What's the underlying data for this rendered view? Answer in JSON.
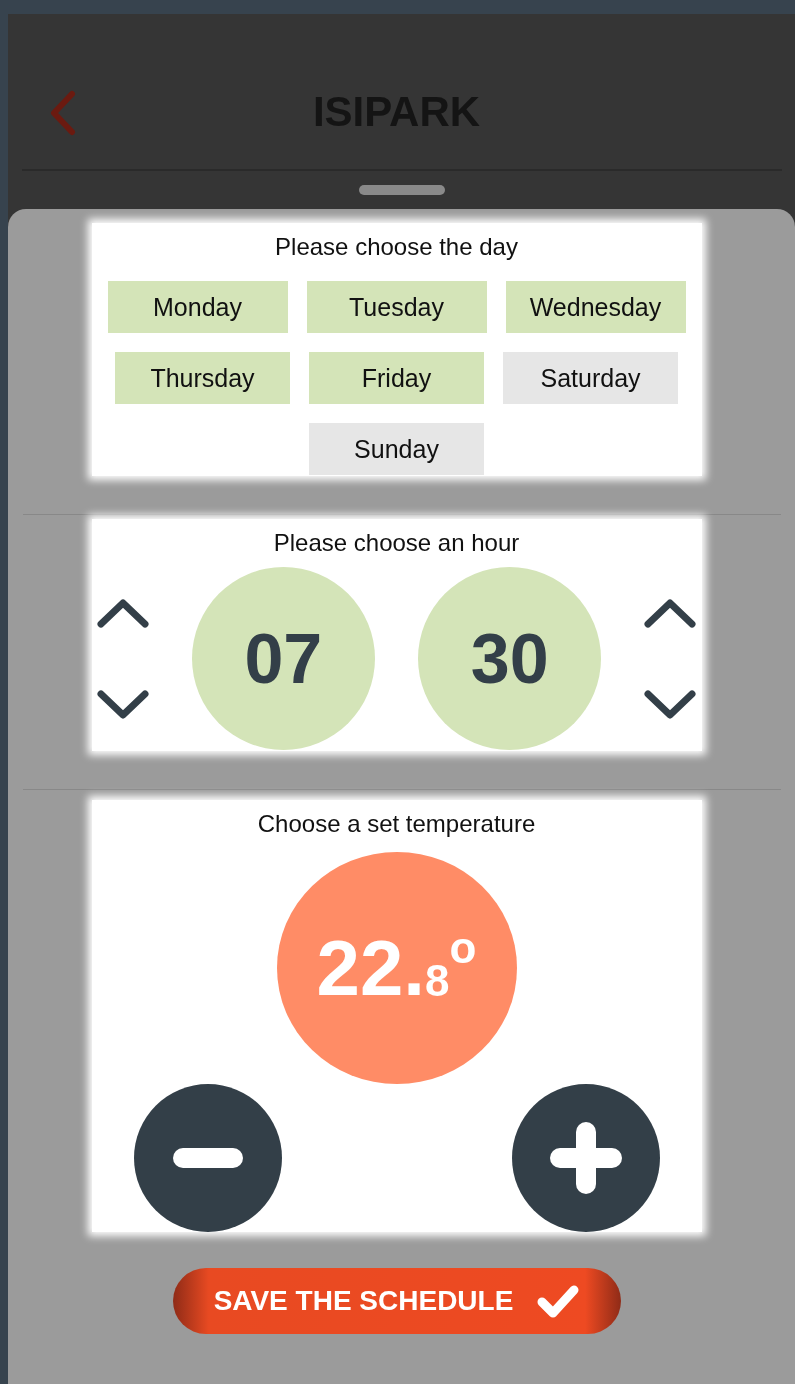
{
  "header": {
    "title": "ISIPARK"
  },
  "day_card": {
    "title": "Please choose the day",
    "days": [
      {
        "label": "Monday",
        "selected": true
      },
      {
        "label": "Tuesday",
        "selected": true
      },
      {
        "label": "Wednesday",
        "selected": true
      },
      {
        "label": "Thursday",
        "selected": true
      },
      {
        "label": "Friday",
        "selected": true
      },
      {
        "label": "Saturday",
        "selected": false
      },
      {
        "label": "Sunday",
        "selected": false
      }
    ]
  },
  "hour_card": {
    "title": "Please choose an hour",
    "hours": "07",
    "minutes": "30"
  },
  "temperature_card": {
    "title": "Choose a set temperature",
    "whole": "22.",
    "decimal": "8",
    "unit": "o"
  },
  "save_button": {
    "label": "SAVE THE SCHEDULE"
  }
}
